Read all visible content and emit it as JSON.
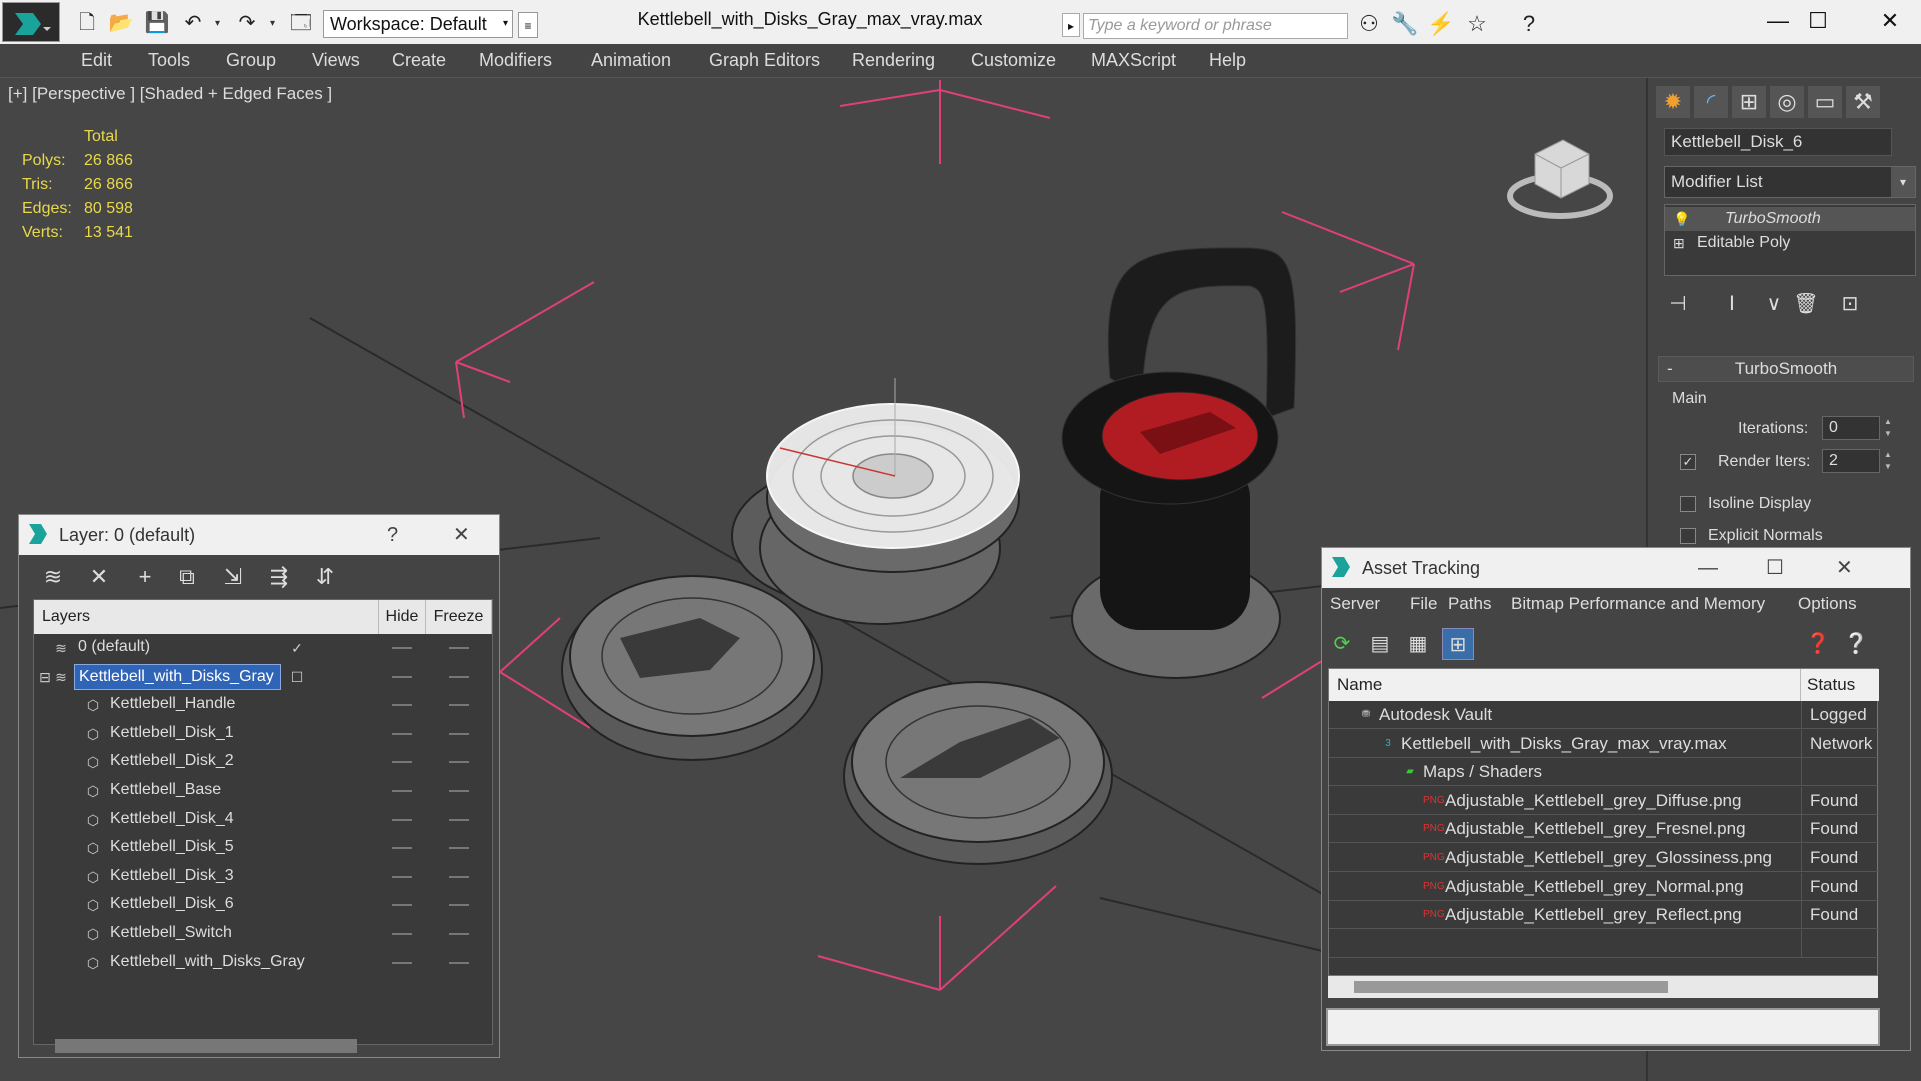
{
  "app": {
    "document_title": "Kettlebell_with_Disks_Gray_max_vray.max",
    "workspace_label": "Workspace: Default",
    "search_placeholder": "Type a keyword or phrase"
  },
  "menubar": [
    "Edit",
    "Tools",
    "Group",
    "Views",
    "Create",
    "Modifiers",
    "Animation",
    "Graph Editors",
    "Rendering",
    "Customize",
    "MAXScript",
    "Help"
  ],
  "viewport": {
    "label": "[+] [Perspective ] [Shaded + Edged Faces ]",
    "stats": {
      "header": "Total",
      "rows": [
        {
          "label": "Polys:",
          "value": "26 866"
        },
        {
          "label": "Tris:",
          "value": "26 866"
        },
        {
          "label": "Edges:",
          "value": "80 598"
        },
        {
          "label": "Verts:",
          "value": "13 541"
        }
      ]
    }
  },
  "command_panel": {
    "object_name": "Kettlebell_Disk_6",
    "modifier_list_label": "Modifier List",
    "stack": [
      "TurboSmooth",
      "Editable Poly"
    ],
    "rollout_title": "TurboSmooth",
    "group_main": "Main",
    "iterations_label": "Iterations:",
    "iterations_value": "0",
    "render_iters_label": "Render Iters:",
    "render_iters_value": "2",
    "render_iters_checked": true,
    "isoline_label": "Isoline Display",
    "explicit_normals_label": "Explicit Normals"
  },
  "layer_dialog": {
    "title": "Layer: 0 (default)",
    "help": "?",
    "columns": {
      "layers": "Layers",
      "hide": "Hide",
      "freeze": "Freeze"
    },
    "rows": [
      {
        "name": "0 (default)",
        "type": "layer",
        "indent": 0,
        "current": true
      },
      {
        "name": "Kettlebell_with_Disks_Gray",
        "type": "layer",
        "indent": 0,
        "selected": true
      },
      {
        "name": "Kettlebell_Handle",
        "type": "object",
        "indent": 1
      },
      {
        "name": "Kettlebell_Disk_1",
        "type": "object",
        "indent": 1
      },
      {
        "name": "Kettlebell_Disk_2",
        "type": "object",
        "indent": 1
      },
      {
        "name": "Kettlebell_Base",
        "type": "object",
        "indent": 1
      },
      {
        "name": "Kettlebell_Disk_4",
        "type": "object",
        "indent": 1
      },
      {
        "name": "Kettlebell_Disk_5",
        "type": "object",
        "indent": 1
      },
      {
        "name": "Kettlebell_Disk_3",
        "type": "object",
        "indent": 1
      },
      {
        "name": "Kettlebell_Disk_6",
        "type": "object",
        "indent": 1
      },
      {
        "name": "Kettlebell_Switch",
        "type": "object",
        "indent": 1
      },
      {
        "name": "Kettlebell_with_Disks_Gray",
        "type": "object",
        "indent": 1
      }
    ]
  },
  "asset_dialog": {
    "title": "Asset Tracking",
    "menu": [
      "Server",
      "File",
      "Paths",
      "Bitmap Performance and Memory",
      "Options"
    ],
    "columns": {
      "name": "Name",
      "status": "Status"
    },
    "rows": [
      {
        "name": "Autodesk Vault",
        "status": "Logged",
        "icon": "vault-icon",
        "indent": 0
      },
      {
        "name": "Kettlebell_with_Disks_Gray_max_vray.max",
        "status": "Network",
        "icon": "max-file-icon",
        "indent": 1
      },
      {
        "name": "Maps / Shaders",
        "status": "",
        "icon": "maps-icon",
        "indent": 2
      },
      {
        "name": "Adjustable_Kettlebell_grey_Diffuse.png",
        "status": "Found",
        "icon": "png-icon",
        "indent": 3
      },
      {
        "name": "Adjustable_Kettlebell_grey_Fresnel.png",
        "status": "Found",
        "icon": "png-icon",
        "indent": 3
      },
      {
        "name": "Adjustable_Kettlebell_grey_Glossiness.png",
        "status": "Found",
        "icon": "png-icon",
        "indent": 3
      },
      {
        "name": "Adjustable_Kettlebell_grey_Normal.png",
        "status": "Found",
        "icon": "png-icon",
        "indent": 3
      },
      {
        "name": "Adjustable_Kettlebell_grey_Reflect.png",
        "status": "Found",
        "icon": "png-icon",
        "indent": 3
      }
    ]
  },
  "colors": {
    "stats_yellow": "#e8d94a",
    "selection_blue": "#3064b6",
    "gizmo_pink": "#e0407a",
    "kettlebell_red": "#b01c22"
  }
}
